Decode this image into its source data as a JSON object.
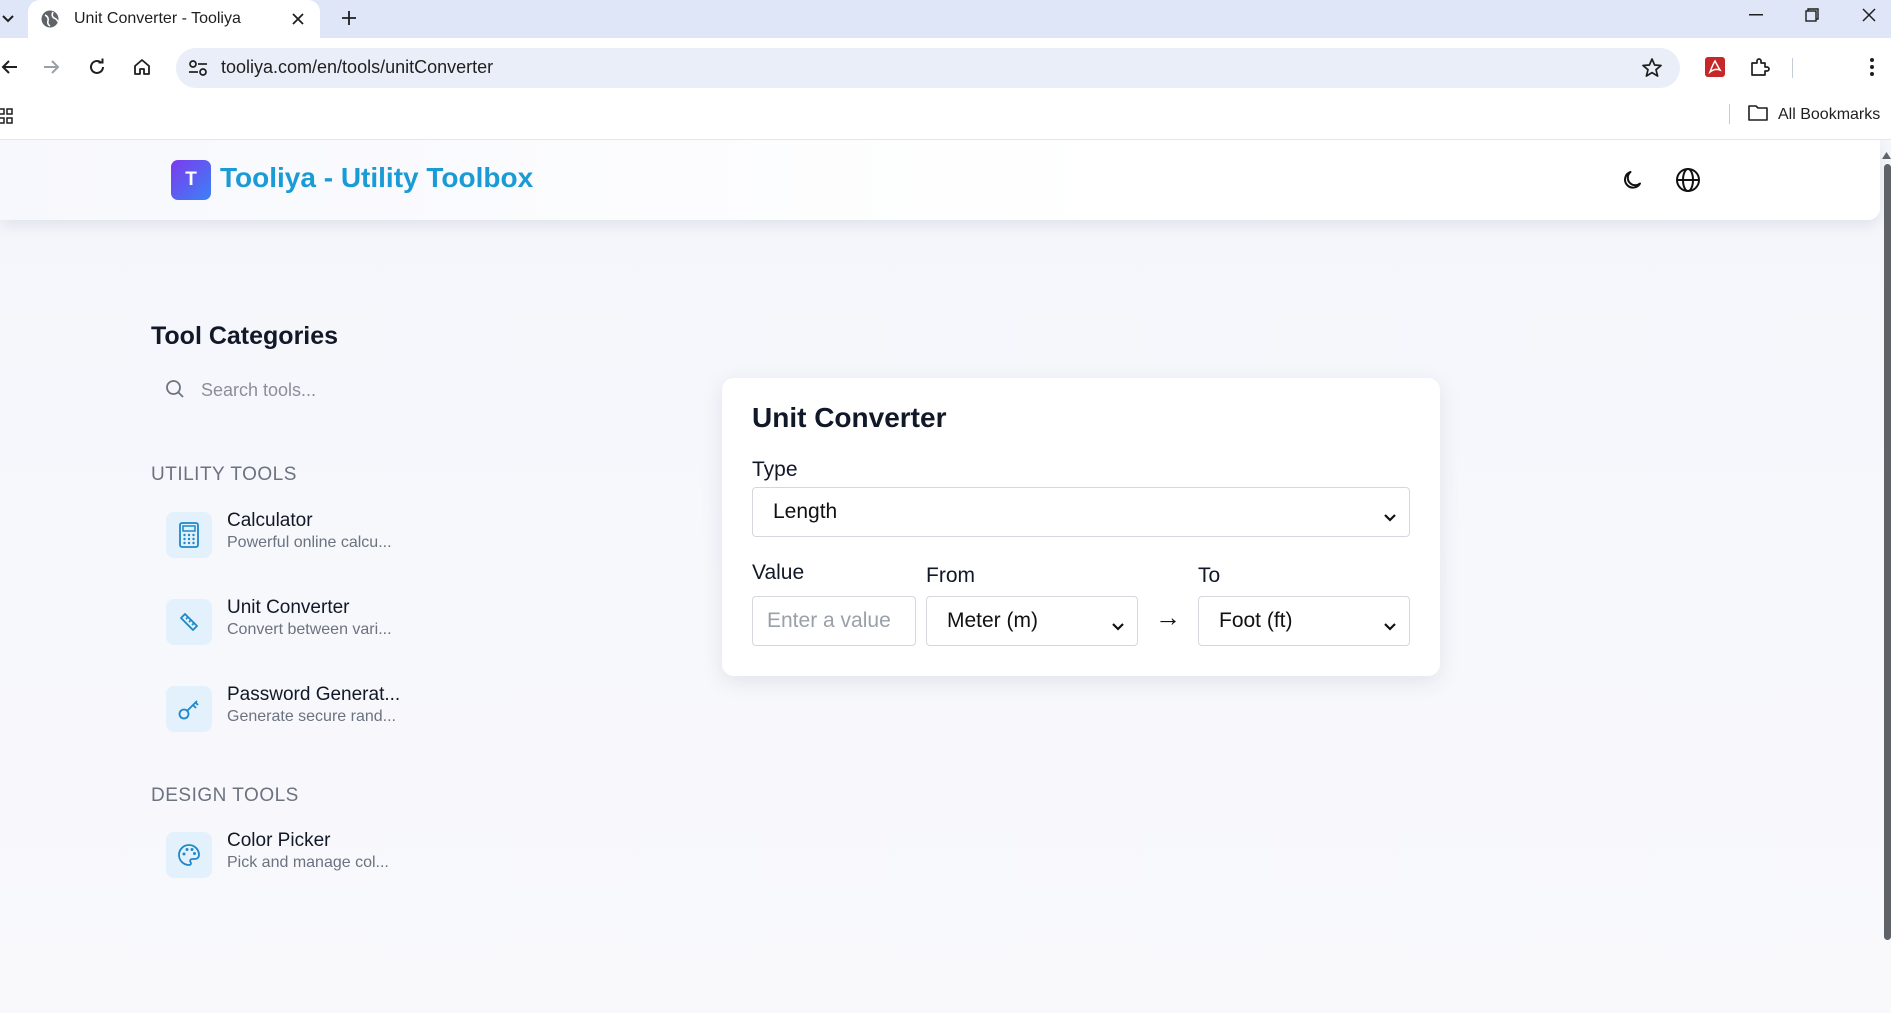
{
  "browser": {
    "tab_title": "Unit Converter - Tooliya",
    "url": "tooliya.com/en/tools/unitConverter",
    "all_bookmarks_label": "All Bookmarks"
  },
  "header": {
    "logo_letter": "T",
    "site_title": "Tooliya - Utility Toolbox"
  },
  "sidebar": {
    "title": "Tool Categories",
    "search_placeholder": "Search tools...",
    "sections": [
      {
        "title": "UTILITY TOOLS",
        "items": [
          {
            "name": "Calculator",
            "desc": "Powerful online calcu...",
            "icon": "calculator-icon"
          },
          {
            "name": "Unit Converter",
            "desc": "Convert between vari...",
            "icon": "ruler-icon"
          },
          {
            "name": "Password Generat...",
            "desc": "Generate secure rand...",
            "icon": "key-icon"
          }
        ]
      },
      {
        "title": "DESIGN TOOLS",
        "items": [
          {
            "name": "Color Picker",
            "desc": "Pick and manage col...",
            "icon": "palette-icon"
          }
        ]
      }
    ]
  },
  "converter": {
    "title": "Unit Converter",
    "type_label": "Type",
    "type_value": "Length",
    "value_label": "Value",
    "value_placeholder": "Enter a value",
    "from_label": "From",
    "from_value": "Meter (m)",
    "to_label": "To",
    "to_value": "Foot (ft)",
    "arrow": "→"
  },
  "colors": {
    "brand_text": "#1a9bd6",
    "logo_gradient_start": "#7c3aed",
    "logo_gradient_end": "#3b82f6",
    "icon_bg": "#e2f1fc",
    "icon_stroke": "#1e88c8"
  }
}
